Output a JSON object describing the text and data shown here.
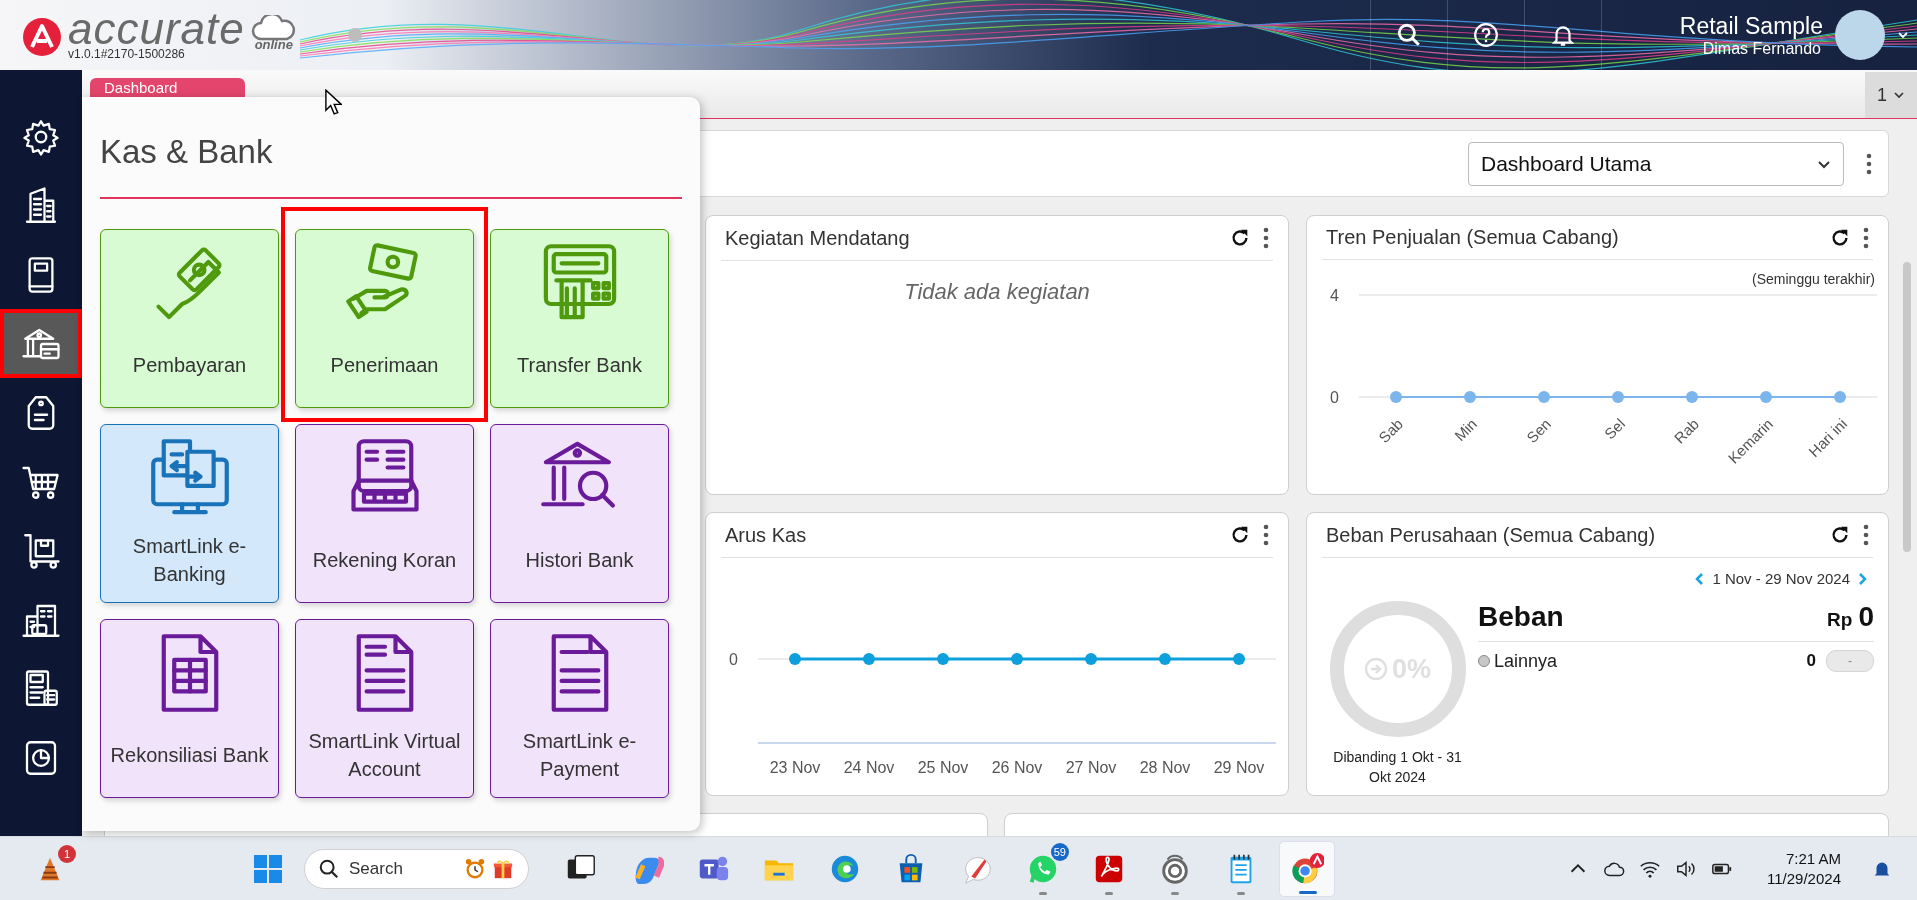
{
  "header": {
    "logo_text": "accurate",
    "logo_subtext": "online",
    "version": "v1.0.1#2170-1500286",
    "company": "Retail Sample",
    "user": "Dimas Fernando"
  },
  "tabs": [
    {
      "label": "Dashboard",
      "selected": true
    }
  ],
  "tab_counter": "1",
  "sidebar": {
    "items": [
      {
        "kind": "settings",
        "selected": false,
        "highlighted": false
      },
      {
        "kind": "building",
        "selected": false,
        "highlighted": false
      },
      {
        "kind": "book",
        "selected": false,
        "highlighted": false
      },
      {
        "kind": "bank",
        "selected": true,
        "highlighted": true
      },
      {
        "kind": "price-tag",
        "selected": false,
        "highlighted": false
      },
      {
        "kind": "cart",
        "selected": false,
        "highlighted": false
      },
      {
        "kind": "trolley",
        "selected": false,
        "highlighted": false
      },
      {
        "kind": "city",
        "selected": false,
        "highlighted": false
      },
      {
        "kind": "tax",
        "selected": false,
        "highlighted": false
      },
      {
        "kind": "report",
        "selected": false,
        "highlighted": false
      }
    ]
  },
  "menu": {
    "title": "Kas & Bank",
    "tiles": [
      {
        "kind": "hand-money",
        "label": "Pembayaran",
        "color": "#4f9a0c",
        "highlighted": false
      },
      {
        "kind": "money-receive",
        "label": "Penerimaan",
        "color": "#4f9a0c",
        "highlighted": true
      },
      {
        "kind": "atm",
        "label": "Transfer Bank",
        "color": "#4f9a0c",
        "highlighted": false
      },
      {
        "kind": "ebanking",
        "label": "SmartLink e-Banking",
        "color": "#1a73b8",
        "highlighted": false
      },
      {
        "kind": "statement",
        "label": "Rekening Koran",
        "color": "#6a1b9a",
        "highlighted": false
      },
      {
        "kind": "bank-search",
        "label": "Histori Bank",
        "color": "#6a1b9a",
        "highlighted": false
      },
      {
        "kind": "reconcile",
        "label": "Rekonsiliasi Bank",
        "color": "#6a1b9a",
        "highlighted": false
      },
      {
        "kind": "virtual-account",
        "label": "SmartLink Virtual Account",
        "color": "#6a1b9a",
        "highlighted": false
      },
      {
        "kind": "e-payment",
        "label": "SmartLink e-Payment",
        "color": "#6a1b9a",
        "highlighted": false
      }
    ]
  },
  "dashboard": {
    "selector": "Dashboard Utama"
  },
  "cards": [
    {
      "kind": "activities",
      "title": "Kegiatan Mendatang",
      "empty_text": "Tidak ada kegiatan"
    },
    {
      "kind": "chart",
      "title": "Tren Penjualan (Semua Cabang)",
      "note": "(Seminggu terakhir)",
      "chart_data": {
        "type": "line",
        "categories": [
          "Sab",
          "Min",
          "Sen",
          "Sel",
          "Rab",
          "Kemarin",
          "Hari ini"
        ],
        "series": [
          {
            "color": "#7cb5ec",
            "marker": true,
            "values": [
              0,
              0,
              0,
              0,
              0,
              0,
              0
            ]
          }
        ],
        "yticks": [
          0,
          4
        ],
        "ylim": [
          0,
          4
        ]
      }
    },
    {
      "kind": "flat-chart",
      "title": "Arus Kas",
      "y_label": "0",
      "x_labels": [
        "23 Nov",
        "24 Nov",
        "25 Nov",
        "26 Nov",
        "27 Nov",
        "28 Nov",
        "29 Nov"
      ]
    },
    {
      "kind": "expense",
      "title": "Beban Perusahaan (Semua Cabang)",
      "period": "1 Nov - 29 Nov 2024",
      "percent": "0%",
      "comparison": "Dibanding 1 Okt - 31 Okt 2024",
      "total_label": "Beban",
      "currency": "Rp",
      "total": "0",
      "items": [
        {
          "label": "Lainnya",
          "value": "0",
          "badge": "-",
          "color": "#c8c8c8"
        }
      ]
    }
  ],
  "taskbar": {
    "widgets_badge": "1",
    "search": {
      "placeholder": "Search"
    },
    "apps": [
      {
        "kind": "task-view",
        "running": false,
        "selected": false
      },
      {
        "kind": "copilot",
        "running": false,
        "selected": false
      },
      {
        "kind": "teams",
        "running": false,
        "selected": false
      },
      {
        "kind": "explorer",
        "running": false,
        "selected": false
      },
      {
        "kind": "edge",
        "running": false,
        "selected": false
      },
      {
        "kind": "store",
        "running": false,
        "selected": false
      },
      {
        "kind": "feather",
        "running": false,
        "selected": false
      },
      {
        "kind": "whatsapp",
        "running": true,
        "selected": false,
        "badge": "59"
      },
      {
        "kind": "acrobat",
        "running": true,
        "selected": false
      },
      {
        "kind": "ring",
        "running": true,
        "selected": false
      },
      {
        "kind": "notepad",
        "running": true,
        "selected": false
      },
      {
        "kind": "chrome",
        "running": true,
        "selected": true
      }
    ],
    "time": "7:21 AM",
    "date": "11/29/2024"
  }
}
